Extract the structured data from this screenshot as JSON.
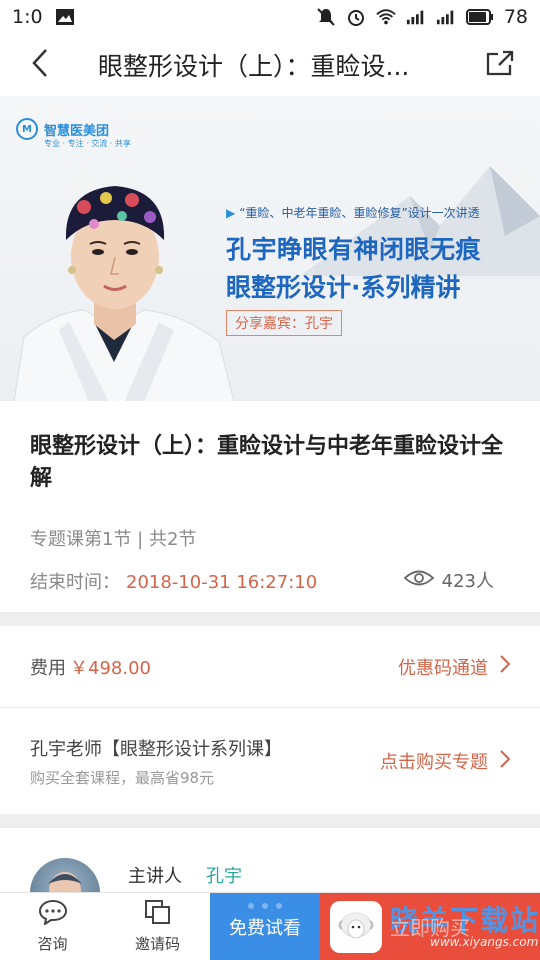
{
  "status_bar": {
    "time": "1:0",
    "battery": "78"
  },
  "header": {
    "title": "眼整形设计（上）：重睑设...",
    "back_icon": "chevron-left-icon",
    "share_icon": "share-icon"
  },
  "banner": {
    "logo_name": "智慧医美团",
    "logo_sub": "专业 · 专注 · 交流 · 共享",
    "tagline": "“重睑、中老年重睑、重睑修复”设计一次讲透",
    "headline1": "孔宇睁眼有神闭眼无痕",
    "headline2": "眼整形设计·系列精讲",
    "guest": "分享嘉宾：孔宇"
  },
  "course": {
    "title": "眼整形设计（上）：重睑设计与中老年重睑设计全解",
    "lesson_info": "专题课第1节 | 共2节",
    "end_label": "结束时间：",
    "end_time": "2018-10-31 16:27:10",
    "views": "423人"
  },
  "price": {
    "label": "费用",
    "value": "￥498.00",
    "coupon_link": "优惠码通道"
  },
  "series": {
    "title": "孔宇老师【眼整形设计系列课】",
    "subtitle": "购买全套课程，最高省98元",
    "buy_link": "点击购买专题"
  },
  "lecturer": {
    "label": "主讲人",
    "name": "孔宇"
  },
  "bottom_bar": {
    "consult": "咨询",
    "invite_code": "邀请码",
    "free_trial": "免费试看",
    "buy_now": "立即购买"
  },
  "watermark": {
    "text": "晓羊下载站",
    "url": "www.xiyangs.com"
  },
  "colors": {
    "accent_red": "#d4654a",
    "buy_button": "#e94e3c",
    "trial_button": "#3a8ee6",
    "teal": "#2ba7a0",
    "banner_blue": "#1e67c0"
  }
}
